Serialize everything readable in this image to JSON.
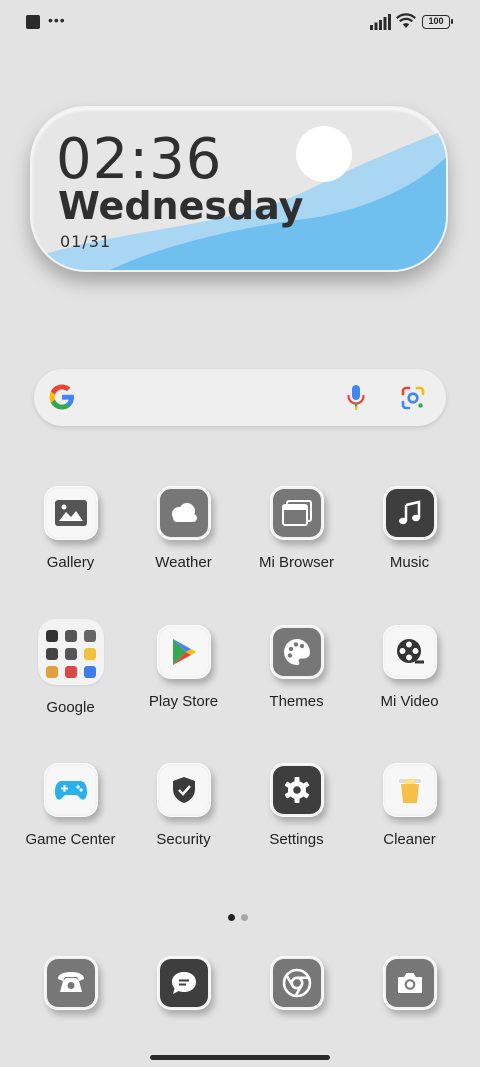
{
  "status_bar": {
    "more_dots": "•••",
    "battery": "100"
  },
  "clock_widget": {
    "time": "02:36",
    "day": "Wednesday",
    "date": "01/31"
  },
  "search_bar": {
    "logo_icon": "google-g-icon",
    "voice_icon": "mic-icon",
    "lens_icon": "google-lens-icon"
  },
  "apps": [
    {
      "label": "Gallery",
      "icon": "gallery-icon"
    },
    {
      "label": "Weather",
      "icon": "weather-icon"
    },
    {
      "label": "Mi Browser",
      "icon": "browser-icon"
    },
    {
      "label": "Music",
      "icon": "music-icon"
    },
    {
      "label": "Google",
      "icon": "google-folder-icon"
    },
    {
      "label": "Play Store",
      "icon": "play-store-icon"
    },
    {
      "label": "Themes",
      "icon": "palette-icon"
    },
    {
      "label": "Mi Video",
      "icon": "film-reel-icon"
    },
    {
      "label": "Game Center",
      "icon": "gamepad-icon"
    },
    {
      "label": "Security",
      "icon": "shield-check-icon"
    },
    {
      "label": "Settings",
      "icon": "gear-icon"
    },
    {
      "label": "Cleaner",
      "icon": "trash-icon"
    }
  ],
  "pager": {
    "current": 1,
    "total": 2
  },
  "dock": [
    {
      "icon": "phone-icon"
    },
    {
      "icon": "messages-icon"
    },
    {
      "icon": "chrome-icon"
    },
    {
      "icon": "camera-icon"
    }
  ],
  "colors": {
    "background": "#e3e3e3",
    "widget_blue": "#6fbfef",
    "widget_light_blue": "#a9d6f2",
    "game_center_accent": "#2ab0ea"
  }
}
